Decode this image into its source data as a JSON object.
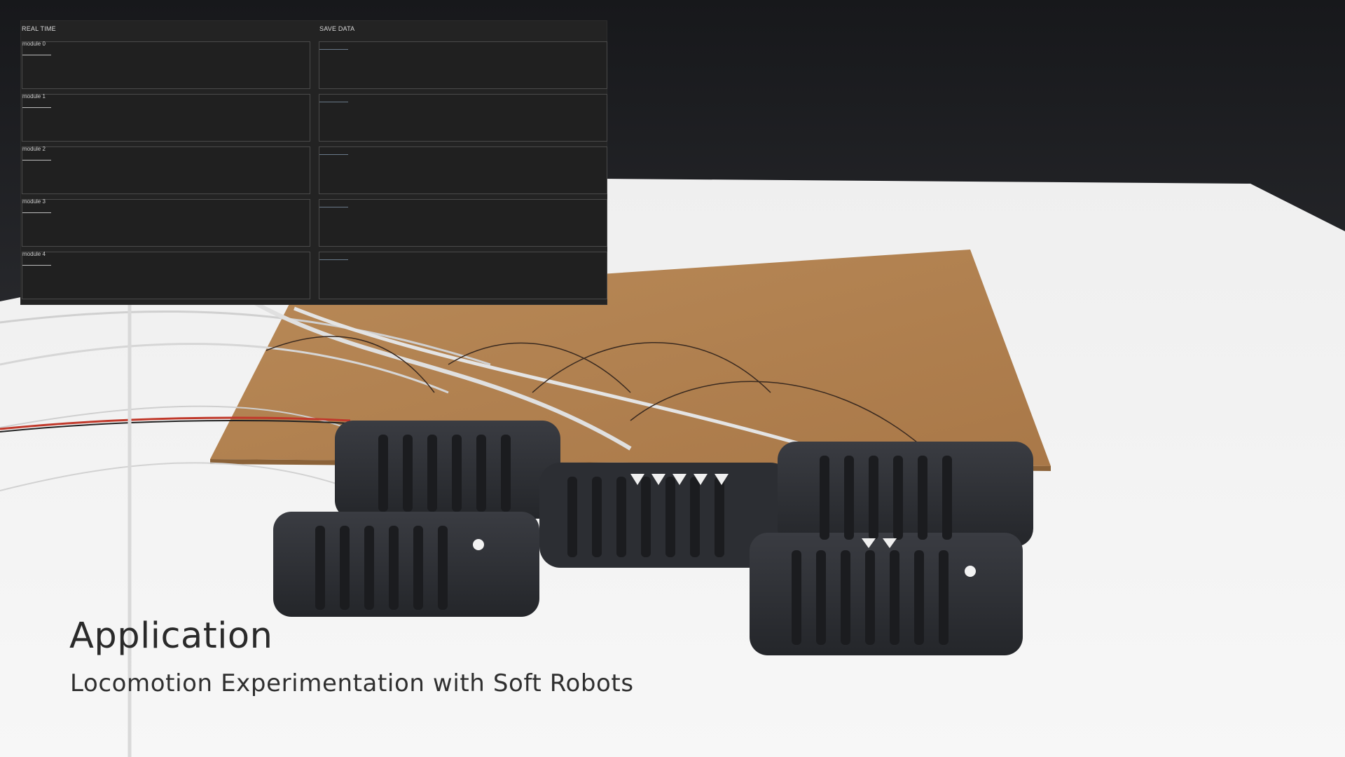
{
  "panel": {
    "realtime_header": "REAL TIME",
    "savedata_header": "SAVE DATA",
    "modules": [
      {
        "label": "module 0"
      },
      {
        "label": "module 1"
      },
      {
        "label": "module 2"
      },
      {
        "label": "module 3"
      },
      {
        "label": "module 4"
      }
    ]
  },
  "caption": {
    "title": "Application",
    "subtitle": "Locomotion Experimentation with Soft Robots"
  },
  "colors": {
    "panel_bg": "#232323",
    "plot_border": "#4a4a4a",
    "table_top": "#f1f1f1",
    "cork_board": "#b5834f",
    "robot_body": "#2e3035"
  }
}
